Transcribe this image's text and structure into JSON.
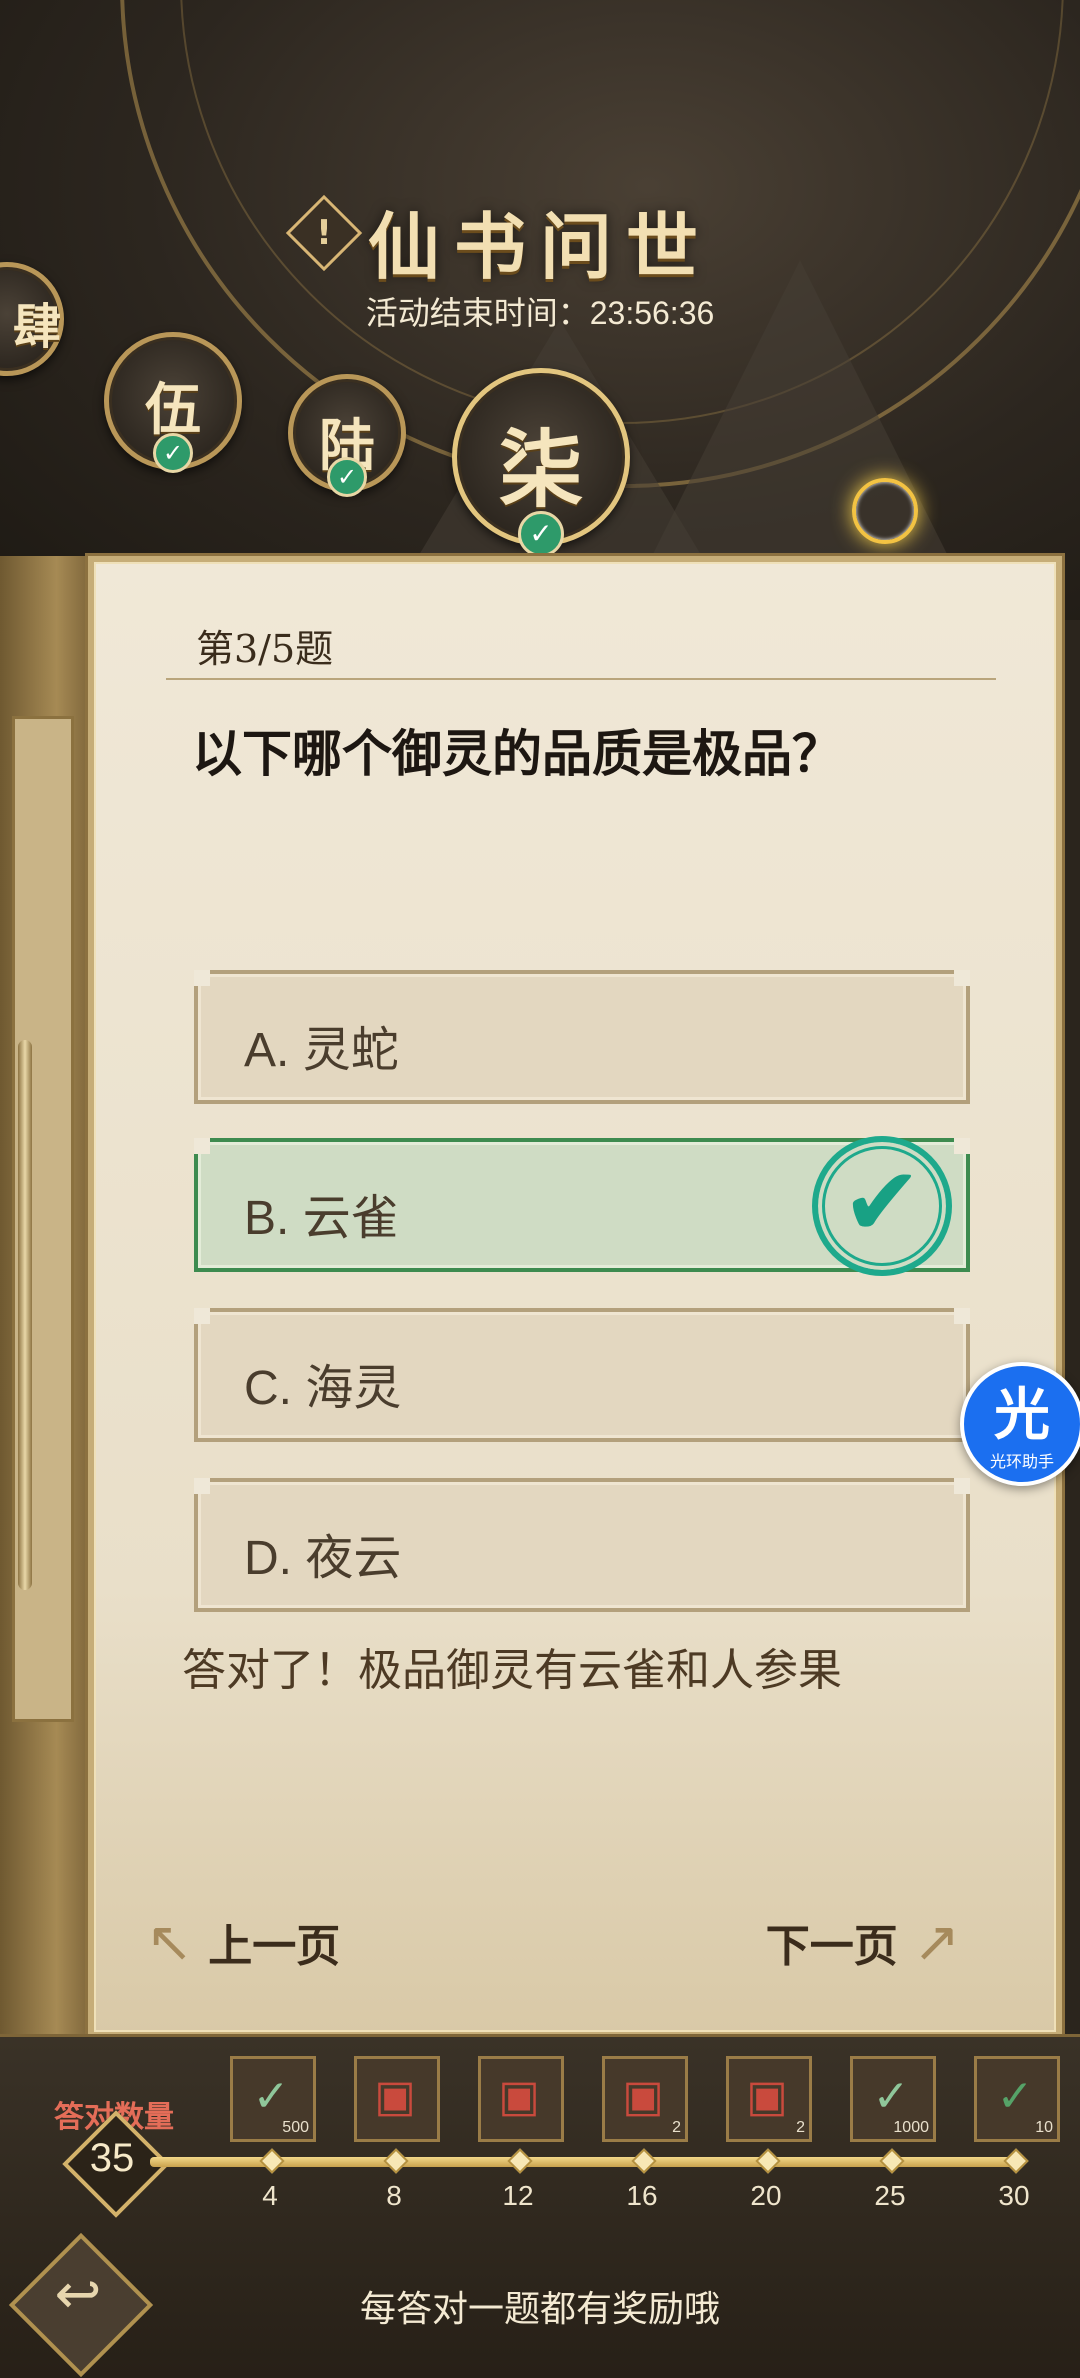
{
  "header": {
    "title": "仙书问世",
    "info_icon_glyph": "!",
    "countdown_label": "活动结束时间：",
    "countdown_value": "23:56:36"
  },
  "chapters": [
    {
      "char": "肆",
      "completed": true
    },
    {
      "char": "伍",
      "completed": true
    },
    {
      "char": "陆",
      "completed": true
    },
    {
      "char": "柒",
      "completed": true,
      "selected": true
    }
  ],
  "quiz": {
    "question_number": "第3/5题",
    "question": "以下哪个御灵的品质是极品？",
    "options": [
      {
        "label": "A. 灵蛇"
      },
      {
        "label": "B. 云雀",
        "correct": true
      },
      {
        "label": "C. 海灵"
      },
      {
        "label": "D. 夜云"
      }
    ],
    "feedback": "答对了！极品御灵有云雀和人参果",
    "prev_label": "上一页",
    "next_label": "下一页"
  },
  "progress": {
    "label": "答对数量",
    "count": "35",
    "rewards": [
      {
        "icon": "scroll-icon",
        "qty": "500",
        "milestone": "4"
      },
      {
        "icon": "chest-icon",
        "qty": "",
        "milestone": "8"
      },
      {
        "icon": "chest-icon",
        "qty": "",
        "milestone": "12"
      },
      {
        "icon": "chest-icon",
        "qty": "2",
        "milestone": "16"
      },
      {
        "icon": "chest-icon",
        "qty": "2",
        "milestone": "20"
      },
      {
        "icon": "scroll-icon",
        "qty": "1000",
        "milestone": "25"
      },
      {
        "icon": "dragon-icon",
        "qty": "10",
        "milestone": "30"
      }
    ]
  },
  "footer": {
    "hint": "每答对一题都有奖励哦"
  },
  "floating_assistant": {
    "glyph": "光",
    "label": "光环助手"
  },
  "colors": {
    "correct_green": "#3d8b4f",
    "check_teal": "#1ea98c",
    "count_label_red": "#e46d58",
    "panel_bg": "#f0e8d7"
  }
}
